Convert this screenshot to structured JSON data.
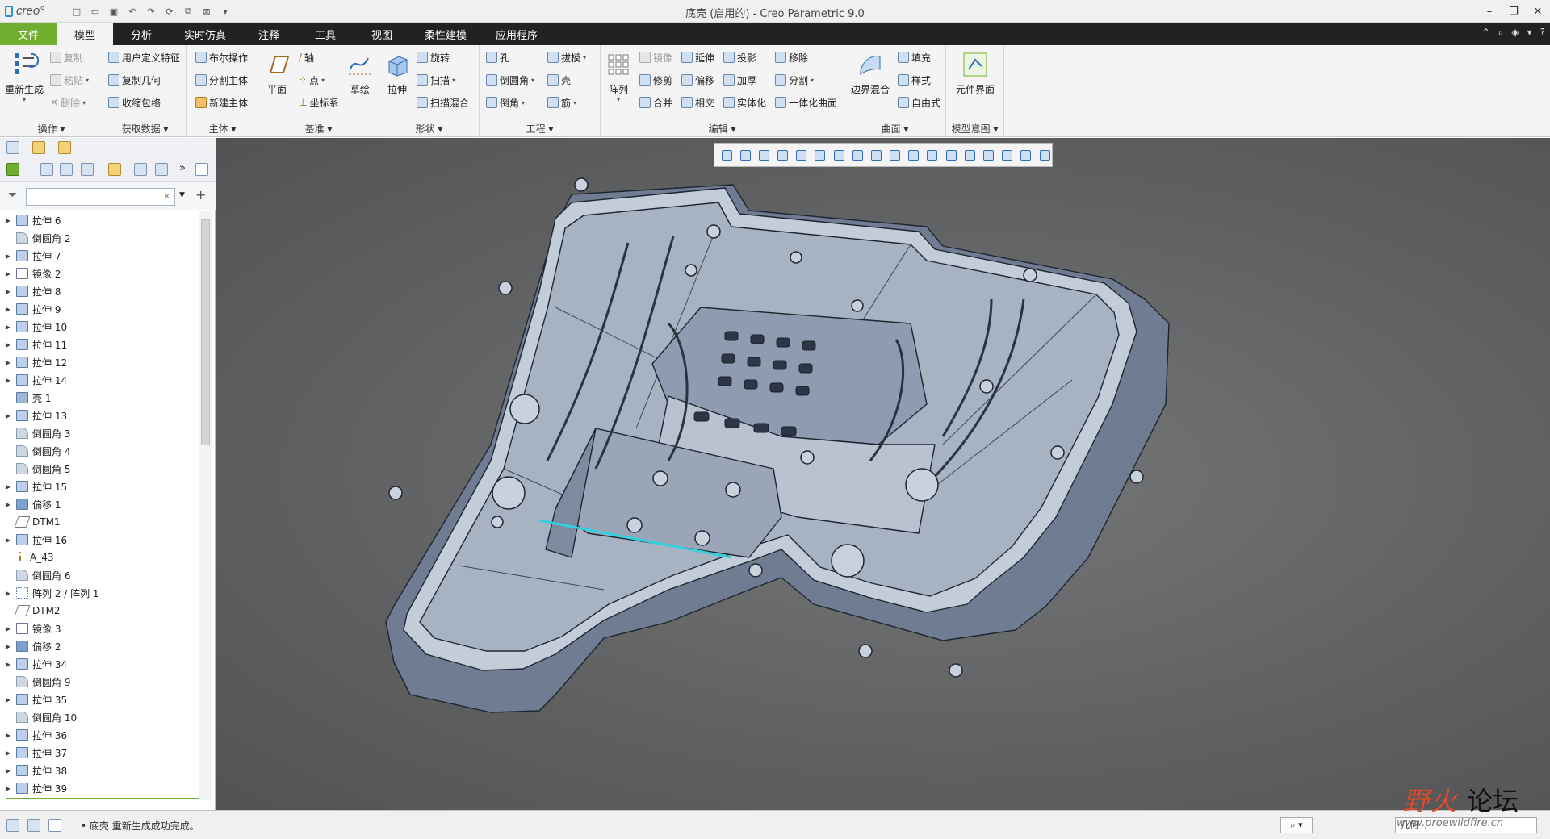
{
  "titlebar": {
    "logo": "creo°",
    "title": "底壳 (启用的) - Creo Parametric 9.0"
  },
  "tabs": [
    "文件",
    "模型",
    "分析",
    "实时仿真",
    "注释",
    "工具",
    "视图",
    "柔性建模",
    "应用程序"
  ],
  "ribbon": {
    "groups": {
      "operations": "操作",
      "getdata": "获取数据",
      "body": "主体",
      "datum": "基准",
      "shape": "形状",
      "engineering": "工程",
      "editing": "编辑",
      "surfaces": "曲面",
      "modelintent": "模型意图"
    },
    "regen": "重新生成",
    "copy": "复制",
    "paste": "粘贴",
    "delete": "删除",
    "udf": "用户定义特征",
    "copygeom": "复制几何",
    "shrinkwrap": "收缩包络",
    "boolean": "布尔操作",
    "splitbody": "分割主体",
    "newbody": "新建主体",
    "plane": "平面",
    "axis": "轴",
    "point": "点",
    "csys": "坐标系",
    "sketch": "草绘",
    "extrude": "拉伸",
    "revolve": "旋转",
    "sweep": "扫描",
    "sweptblend": "扫描混合",
    "hole": "孔",
    "round": "倒圆角",
    "chamfer": "倒角",
    "draft": "拔模",
    "shell": "壳",
    "rib": "筋",
    "pattern": "阵列",
    "mirror": "镜像",
    "trim": "修剪",
    "merge": "合并",
    "extend": "延伸",
    "offset": "偏移",
    "intersect": "相交",
    "project": "投影",
    "thicken": "加厚",
    "solidify": "实体化",
    "remove": "移除",
    "split": "分割",
    "unify": "一体化曲面",
    "boundary": "边界混合",
    "fill": "填充",
    "style": "样式",
    "freestyle": "自由式",
    "cint": "元件界面"
  },
  "tree": [
    {
      "exp": true,
      "icon": "extrude",
      "label": "拉伸 6"
    },
    {
      "exp": false,
      "icon": "fillet",
      "label": "倒圆角 2"
    },
    {
      "exp": true,
      "icon": "extrude",
      "label": "拉伸 7"
    },
    {
      "exp": true,
      "icon": "mirror",
      "label": "镜像 2"
    },
    {
      "exp": true,
      "icon": "extrude",
      "label": "拉伸 8"
    },
    {
      "exp": true,
      "icon": "extrude",
      "label": "拉伸 9"
    },
    {
      "exp": true,
      "icon": "extrude",
      "label": "拉伸 10"
    },
    {
      "exp": true,
      "icon": "extrude",
      "label": "拉伸 11"
    },
    {
      "exp": true,
      "icon": "extrude",
      "label": "拉伸 12"
    },
    {
      "exp": true,
      "icon": "extrude",
      "label": "拉伸 14"
    },
    {
      "exp": false,
      "icon": "shell",
      "label": "壳 1"
    },
    {
      "exp": true,
      "icon": "extrude",
      "label": "拉伸 13"
    },
    {
      "exp": false,
      "icon": "fillet",
      "label": "倒圆角 3"
    },
    {
      "exp": false,
      "icon": "fillet",
      "label": "倒圆角 4"
    },
    {
      "exp": false,
      "icon": "fillet",
      "label": "倒圆角 5"
    },
    {
      "exp": true,
      "icon": "extrude",
      "label": "拉伸 15"
    },
    {
      "exp": true,
      "icon": "offset",
      "label": "偏移 1"
    },
    {
      "exp": false,
      "icon": "datum",
      "label": "DTM1"
    },
    {
      "exp": true,
      "icon": "extrude",
      "label": "拉伸 16"
    },
    {
      "exp": false,
      "icon": "axis",
      "label": "A_43"
    },
    {
      "exp": false,
      "icon": "fillet",
      "label": "倒圆角 6"
    },
    {
      "exp": true,
      "icon": "pattern",
      "label": "阵列 2 / 阵列 1"
    },
    {
      "exp": false,
      "icon": "datum",
      "label": "DTM2"
    },
    {
      "exp": true,
      "icon": "mirror",
      "label": "镜像 3"
    },
    {
      "exp": true,
      "icon": "offset",
      "label": "偏移 2"
    },
    {
      "exp": true,
      "icon": "extrude",
      "label": "拉伸 34"
    },
    {
      "exp": false,
      "icon": "fillet",
      "label": "倒圆角 9"
    },
    {
      "exp": true,
      "icon": "extrude",
      "label": "拉伸 35"
    },
    {
      "exp": false,
      "icon": "fillet",
      "label": "倒圆角 10"
    },
    {
      "exp": true,
      "icon": "extrude",
      "label": "拉伸 36"
    },
    {
      "exp": true,
      "icon": "extrude",
      "label": "拉伸 37"
    },
    {
      "exp": true,
      "icon": "extrude",
      "label": "拉伸 38"
    },
    {
      "exp": true,
      "icon": "extrude",
      "label": "拉伸 39"
    }
  ],
  "status": {
    "message": "• 底壳 重新生成成功完成。",
    "filter": "几何"
  },
  "watermark": {
    "text": "野火论坛",
    "url": "www.proewildfire.cn"
  },
  "colors": {
    "accent": "#6fae2e",
    "highlight": "#35d0e0"
  }
}
